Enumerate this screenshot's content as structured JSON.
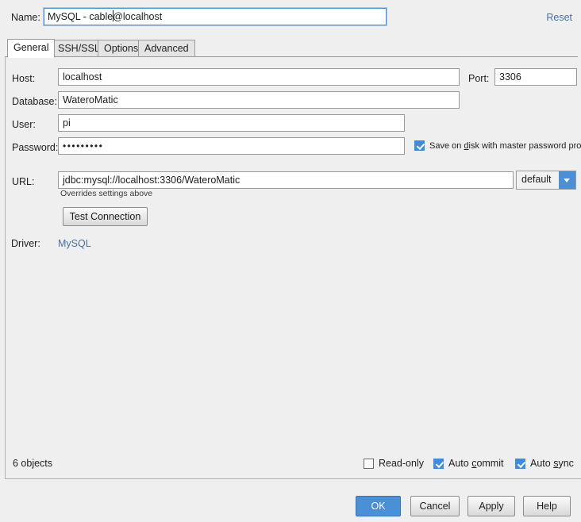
{
  "name_row": {
    "label": "Name:",
    "value_before_caret": "MySQL - cable",
    "value_after_caret": "@localhost",
    "full_value": "MySQL - cable@localhost",
    "reset_label": "Reset"
  },
  "tabs": [
    {
      "label": "General",
      "active": true
    },
    {
      "label": "SSH/SSL",
      "active": false
    },
    {
      "label": "Options",
      "active": false
    },
    {
      "label": "Advanced",
      "active": false
    }
  ],
  "general": {
    "host_label": "Host:",
    "host_value": "localhost",
    "port_label": "Port:",
    "port_value": "3306",
    "database_label": "Database:",
    "database_value": "WateroMatic",
    "user_label": "User:",
    "user_value": "pi",
    "password_label": "Password:",
    "password_value": "•••••••••",
    "save_on_disk": {
      "checked": true,
      "label_before": "Save on ",
      "label_mnemonic": "d",
      "label_after": "isk with master password protection",
      "label_full": "Save on disk with master password protection"
    },
    "url_label": "URL:",
    "url_value": "jdbc:mysql://localhost:3306/WateroMatic",
    "url_combo_value": "default",
    "url_combo_arrow_icon": "chevron-down-icon",
    "overrides_note": "Overrides settings above",
    "test_connection_label": "Test Connection",
    "driver_label": "Driver:",
    "driver_value": "MySQL"
  },
  "statusbar": {
    "objects_count": "6 objects",
    "read_only": {
      "checked": false,
      "label": "Read-only"
    },
    "auto_commit": {
      "checked": true,
      "label_before": "Auto ",
      "label_mnemonic": "c",
      "label_after": "ommit",
      "label_full": "Auto commit"
    },
    "auto_sync": {
      "checked": true,
      "label_before": "Auto ",
      "label_mnemonic": "s",
      "label_after": "ync",
      "label_full": "Auto sync"
    }
  },
  "buttons": {
    "ok": "OK",
    "cancel": "Cancel",
    "apply": "Apply",
    "help": "Help"
  },
  "colors": {
    "accent": "#4a90d9",
    "link": "#4a6fa5",
    "background": "#efefef",
    "field_border": "#9a9a9a"
  }
}
